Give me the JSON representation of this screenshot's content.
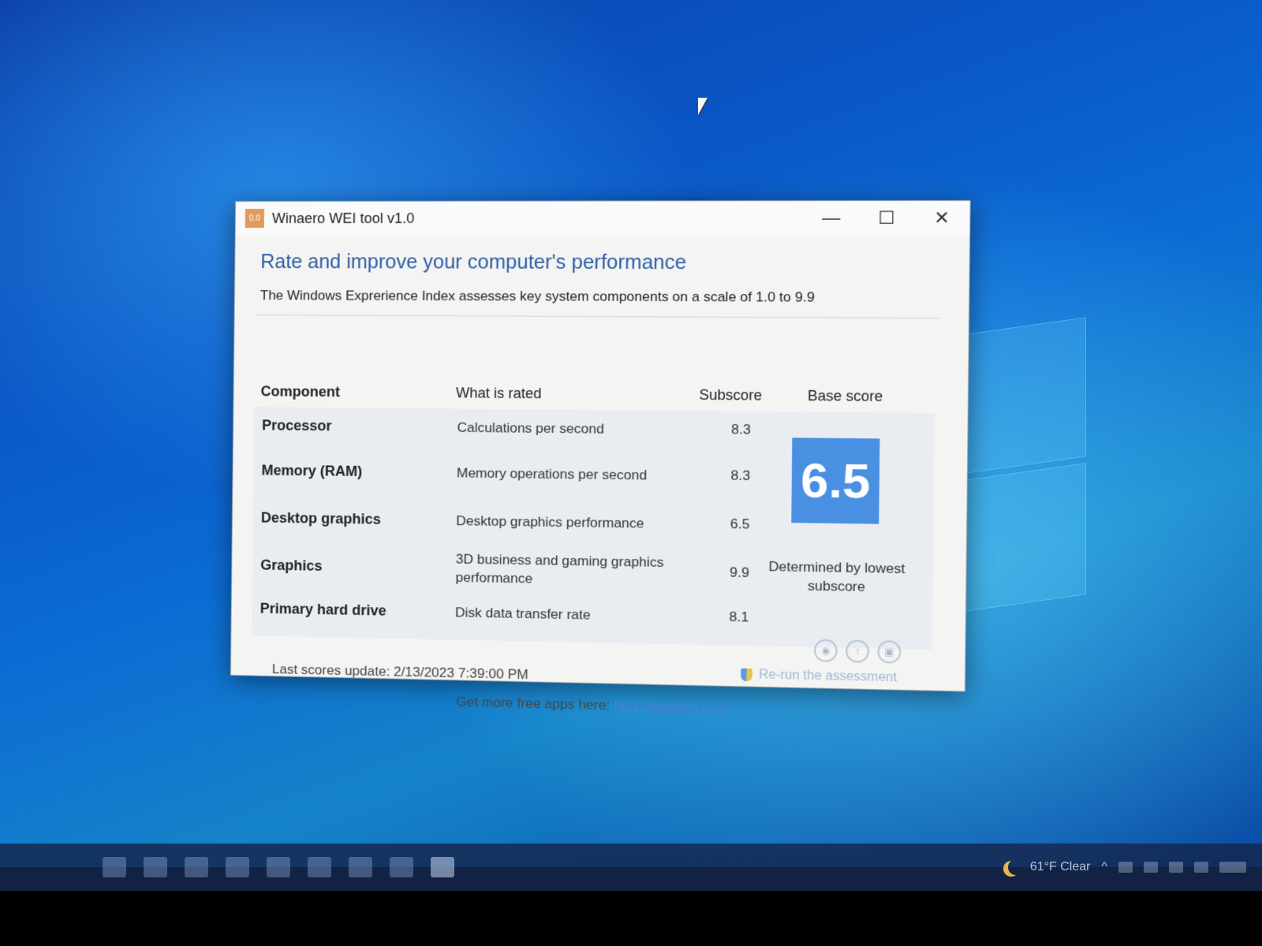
{
  "window": {
    "app_icon_text": "0.0",
    "title": "Winaero WEI tool v1.0",
    "controls": {
      "minimize": "—",
      "maximize": "☐",
      "close": "✕"
    }
  },
  "header": {
    "heading": "Rate and improve your computer's performance",
    "subtitle": "The Windows Exprerience Index assesses key system components on a scale of 1.0 to 9.9"
  },
  "table": {
    "columns": {
      "component": "Component",
      "what": "What is rated",
      "subscore": "Subscore",
      "base": "Base score"
    },
    "rows": [
      {
        "component": "Processor",
        "what": "Calculations per second",
        "subscore": "8.3"
      },
      {
        "component": "Memory (RAM)",
        "what": "Memory operations per second",
        "subscore": "8.3"
      },
      {
        "component": "Desktop graphics",
        "what": "Desktop graphics performance",
        "subscore": "6.5"
      },
      {
        "component": "Graphics",
        "what": "3D business and gaming graphics performance",
        "subscore": "9.9"
      },
      {
        "component": "Primary hard drive",
        "what": "Disk data transfer rate",
        "subscore": "8.1"
      }
    ],
    "base_score": "6.5",
    "base_note": "Determined by lowest subscore"
  },
  "status": {
    "last_update": "Last scores update: 2/13/2023 7:39:00 PM",
    "rerun": "Re-run the assessment"
  },
  "footer": {
    "text": "Get more free apps here: ",
    "link": "http://winaero.com"
  },
  "taskbar": {
    "weather": "61°F  Clear"
  },
  "colors": {
    "accent": "#4a90e2",
    "heading": "#2f5ea8"
  }
}
